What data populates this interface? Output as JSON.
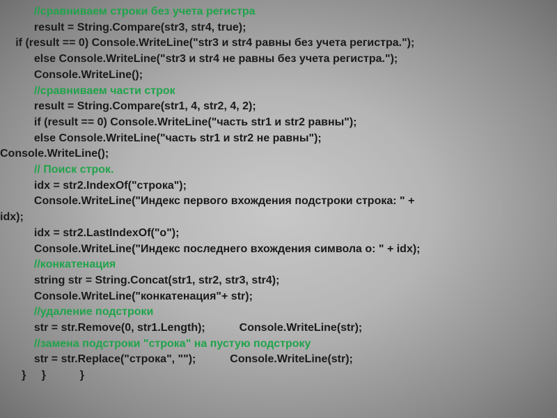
{
  "lines": [
    {
      "indent": "           ",
      "type": "cmt",
      "text": "//сравниваем строки без учета регистра"
    },
    {
      "indent": "           ",
      "type": "code",
      "text": "result = String.Compare(str3, str4, true);"
    },
    {
      "indent": "     ",
      "type": "code",
      "text": "if (result == 0) Console.WriteLine(\"str3 и str4 равны без учета регистра.\");"
    },
    {
      "indent": "           ",
      "type": "code",
      "text": "else Console.WriteLine(\"str3 и str4 не равны без учета регистра.\");"
    },
    {
      "indent": "           ",
      "type": "code",
      "text": "Console.WriteLine();"
    },
    {
      "indent": "           ",
      "type": "cmt",
      "text": "//сравниваем части строк"
    },
    {
      "indent": "           ",
      "type": "code",
      "text": "result = String.Compare(str1, 4, str2, 4, 2);"
    },
    {
      "indent": "           ",
      "type": "code",
      "text": "if (result == 0) Console.WriteLine(\"часть str1 и str2 равны\");"
    },
    {
      "indent": "           ",
      "type": "code",
      "text": "else Console.WriteLine(\"часть str1 и str2 не равны\");            "
    },
    {
      "indent": "",
      "type": "code",
      "text": "Console.WriteLine();"
    },
    {
      "indent": "           ",
      "type": "cmt",
      "text": "// Поиск строк."
    },
    {
      "indent": "           ",
      "type": "code",
      "text": "idx = str2.IndexOf(\"строка\");"
    },
    {
      "indent": "           ",
      "type": "code",
      "text": "Console.WriteLine(\"Индекс первого вхождения подстроки строка: \" + "
    },
    {
      "indent": "",
      "type": "code",
      "text": "idx);"
    },
    {
      "indent": "           ",
      "type": "code",
      "text": "idx = str2.LastIndexOf(\"o\");"
    },
    {
      "indent": "           ",
      "type": "code",
      "text": "Console.WriteLine(\"Индекс последнего вхождения символа о: \" + idx);"
    },
    {
      "indent": "           ",
      "type": "cmt",
      "text": "//конкатенация"
    },
    {
      "indent": "           ",
      "type": "code",
      "text": "string str = String.Concat(str1, str2, str3, str4);"
    },
    {
      "indent": "           ",
      "type": "code",
      "text": "Console.WriteLine(\"конкатенация\"+ str);"
    },
    {
      "indent": "           ",
      "type": "cmt",
      "text": "//удаление подстроки"
    },
    {
      "indent": "           ",
      "type": "code",
      "text": "str = str.Remove(0, str1.Length);           Console.WriteLine(str);"
    },
    {
      "indent": "           ",
      "type": "cmt",
      "text": "//замена подстроки \"строка\" на пустую подстроку"
    },
    {
      "indent": "           ",
      "type": "code",
      "text": "str = str.Replace(\"строка\", \"\");           Console.WriteLine(str);"
    },
    {
      "indent": "       ",
      "type": "code",
      "text": "}     }           }"
    }
  ]
}
